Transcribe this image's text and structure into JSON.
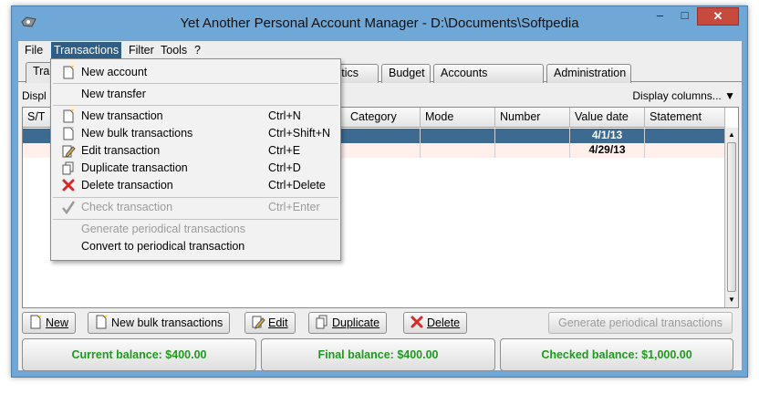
{
  "window": {
    "title": "Yet Another Personal Account Manager - D:\\Documents\\Softpedia"
  },
  "menubar": {
    "file": "File",
    "transactions": "Transactions",
    "filter": "Filter",
    "tools": "Tools",
    "help": "?"
  },
  "tabs": {
    "transactions": "Tra",
    "statistics": "stics",
    "budget": "Budget",
    "accounts_summary": "Accounts summary",
    "administration": "Administration"
  },
  "subbar": {
    "left": "Displ",
    "display_columns": "Display columns..."
  },
  "table": {
    "headers": {
      "st": "S/T",
      "category": "Category",
      "mode": "Mode",
      "number": "Number",
      "value_date": "Value date",
      "statement": "Statement"
    },
    "rows": [
      {
        "value_date": "4/1/13"
      },
      {
        "value_date": "4/29/13"
      }
    ]
  },
  "dropdown": {
    "new_account": "New account",
    "new_transfer": "New transfer",
    "new_transaction": "New transaction",
    "new_transaction_shortcut": "Ctrl+N",
    "new_bulk_transactions": "New bulk transactions",
    "new_bulk_transactions_shortcut": "Ctrl+Shift+N",
    "edit_transaction": "Edit transaction",
    "edit_transaction_shortcut": "Ctrl+E",
    "duplicate_transaction": "Duplicate transaction",
    "duplicate_transaction_shortcut": "Ctrl+D",
    "delete_transaction": "Delete transaction",
    "delete_transaction_shortcut": "Ctrl+Delete",
    "check_transaction": "Check transaction",
    "check_transaction_shortcut": "Ctrl+Enter",
    "generate_periodical": "Generate periodical transactions",
    "convert_periodical": "Convert to periodical transaction"
  },
  "buttons": {
    "new": "New",
    "new_bulk": "New bulk transactions",
    "edit": "Edit",
    "duplicate": "Duplicate",
    "delete": "Delete",
    "generate_periodical": "Generate periodical transactions"
  },
  "balances": {
    "current": "Current balance: $400.00",
    "final": "Final balance: $400.00",
    "checked": "Checked balance: $1,000.00"
  },
  "colors": {
    "selection": "#3d6a90",
    "balance_text": "#1f9a1f",
    "delete_icon": "#d42a2a",
    "titlebar": "#6fa7d6"
  }
}
